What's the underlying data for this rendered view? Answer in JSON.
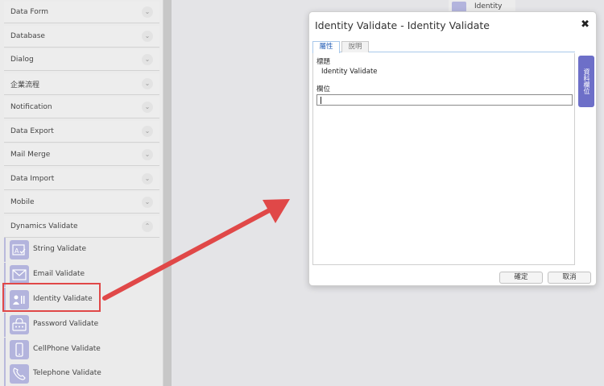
{
  "sidebar": {
    "categories": [
      {
        "label": "Data Form",
        "expanded": false
      },
      {
        "label": "Database",
        "expanded": false
      },
      {
        "label": "Dialog",
        "expanded": false
      },
      {
        "label": "企業流程",
        "expanded": false
      },
      {
        "label": "Notification",
        "expanded": false
      },
      {
        "label": "Data Export",
        "expanded": false
      },
      {
        "label": "Mail Merge",
        "expanded": false
      },
      {
        "label": "Data Import",
        "expanded": false
      },
      {
        "label": "Mobile",
        "expanded": false
      },
      {
        "label": "Dynamics Validate",
        "expanded": true
      }
    ],
    "tools": [
      {
        "label": "String Validate",
        "icon": "string-validate-icon"
      },
      {
        "label": "Email Validate",
        "icon": "envelope-icon"
      },
      {
        "label": "Identity Validate",
        "icon": "id-card-icon"
      },
      {
        "label": "Password Validate",
        "icon": "password-icon"
      },
      {
        "label": "CellPhone Validate",
        "icon": "cellphone-icon"
      },
      {
        "label": "Telephone Validate",
        "icon": "telephone-icon"
      }
    ],
    "chevron_down": "⌄",
    "chevron_up": "⌃"
  },
  "canvas_fragment": {
    "label": "Identity"
  },
  "dialog": {
    "title": "Identity Validate - Identity Validate",
    "close": "✖",
    "tabs": [
      "屬性",
      "說明"
    ],
    "fields": {
      "title_label": "標題",
      "title_value": "Identity Validate",
      "field_label": "欄位",
      "field_value": ""
    },
    "side_tab": "資料欄位",
    "ok_label": "確定",
    "cancel_label": "取消"
  },
  "colors": {
    "accent": "#6d6fc8",
    "icon_bg": "#b3b4dd",
    "arrow": "#e04848"
  }
}
